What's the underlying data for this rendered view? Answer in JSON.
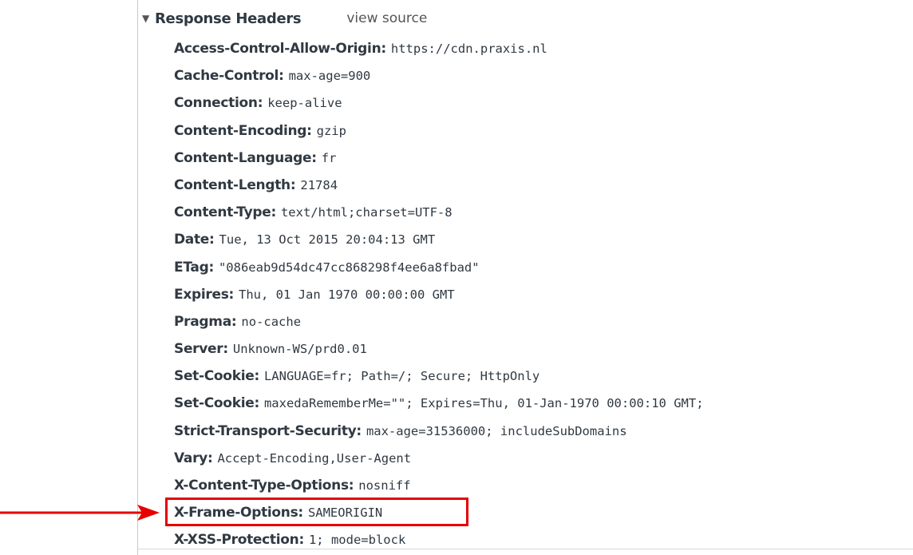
{
  "section": {
    "toggle_icon": "triangle-down-icon",
    "title": "Response Headers",
    "view_source_label": "view source"
  },
  "headers": [
    {
      "name": "Access-Control-Allow-Origin:",
      "value": "https://cdn.praxis.nl"
    },
    {
      "name": "Cache-Control:",
      "value": "max-age=900"
    },
    {
      "name": "Connection:",
      "value": "keep-alive"
    },
    {
      "name": "Content-Encoding:",
      "value": "gzip"
    },
    {
      "name": "Content-Language:",
      "value": "fr"
    },
    {
      "name": "Content-Length:",
      "value": "21784"
    },
    {
      "name": "Content-Type:",
      "value": "text/html;charset=UTF-8"
    },
    {
      "name": "Date:",
      "value": "Tue, 13 Oct 2015 20:04:13 GMT"
    },
    {
      "name": "ETag:",
      "value": "\"086eab9d54dc47cc868298f4ee6a8fbad\""
    },
    {
      "name": "Expires:",
      "value": "Thu, 01 Jan 1970 00:00:00 GMT"
    },
    {
      "name": "Pragma:",
      "value": "no-cache"
    },
    {
      "name": "Server:",
      "value": "Unknown-WS/prd0.01"
    },
    {
      "name": "Set-Cookie:",
      "value": "LANGUAGE=fr; Path=/; Secure; HttpOnly"
    },
    {
      "name": "Set-Cookie:",
      "value": "maxedaRememberMe=\"\"; Expires=Thu, 01-Jan-1970 00:00:10 GMT;"
    },
    {
      "name": "Strict-Transport-Security:",
      "value": "max-age=31536000; includeSubDomains"
    },
    {
      "name": "Vary:",
      "value": "Accept-Encoding,User-Agent"
    },
    {
      "name": "X-Content-Type-Options:",
      "value": "nosniff"
    },
    {
      "name": "X-Frame-Options:",
      "value": "SAMEORIGIN"
    },
    {
      "name": "X-XSS-Protection:",
      "value": "1; mode=block"
    }
  ],
  "annotation": {
    "highlighted_header": "X-Frame-Options",
    "arrow_icon": "red-arrow-icon",
    "color": "#e60000"
  }
}
